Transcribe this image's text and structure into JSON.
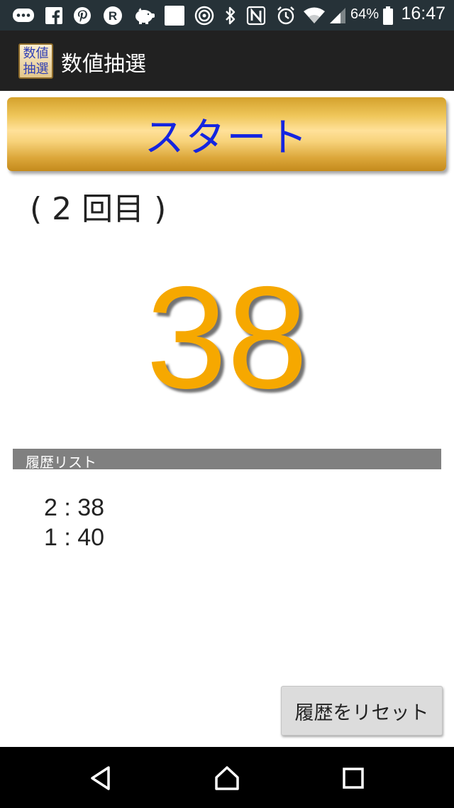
{
  "status_bar": {
    "battery_text": "64%",
    "time": "16:47",
    "icons": [
      "chat-icon",
      "facebook-icon",
      "pinterest-icon",
      "rakuten-icon",
      "piggy-bank-icon",
      "blank-square-icon",
      "nfc-felica-icon",
      "bluetooth-icon",
      "n-mark-icon",
      "alarm-icon",
      "wifi-icon",
      "signal-icon",
      "battery-icon"
    ]
  },
  "app_bar": {
    "logo_lines": [
      "数値",
      "抽選"
    ],
    "title": "数値抽選"
  },
  "main": {
    "start_button_label": "スタート",
    "round_count": "( 2 回目 )",
    "result_number": "38",
    "result_color": "#f6a800",
    "history_header": "履歴リスト",
    "history": [
      "2 : 38",
      "1 : 40"
    ],
    "reset_button_label": "履歴をリセット"
  },
  "nav_bar": {
    "icons": [
      "back-icon",
      "home-icon",
      "recents-icon"
    ]
  },
  "colors": {
    "status_bar_bg": "#263238",
    "app_bar_bg": "#212121",
    "start_text": "#1425e0",
    "start_gold": "#efc65a",
    "history_header_bg": "#808080"
  }
}
